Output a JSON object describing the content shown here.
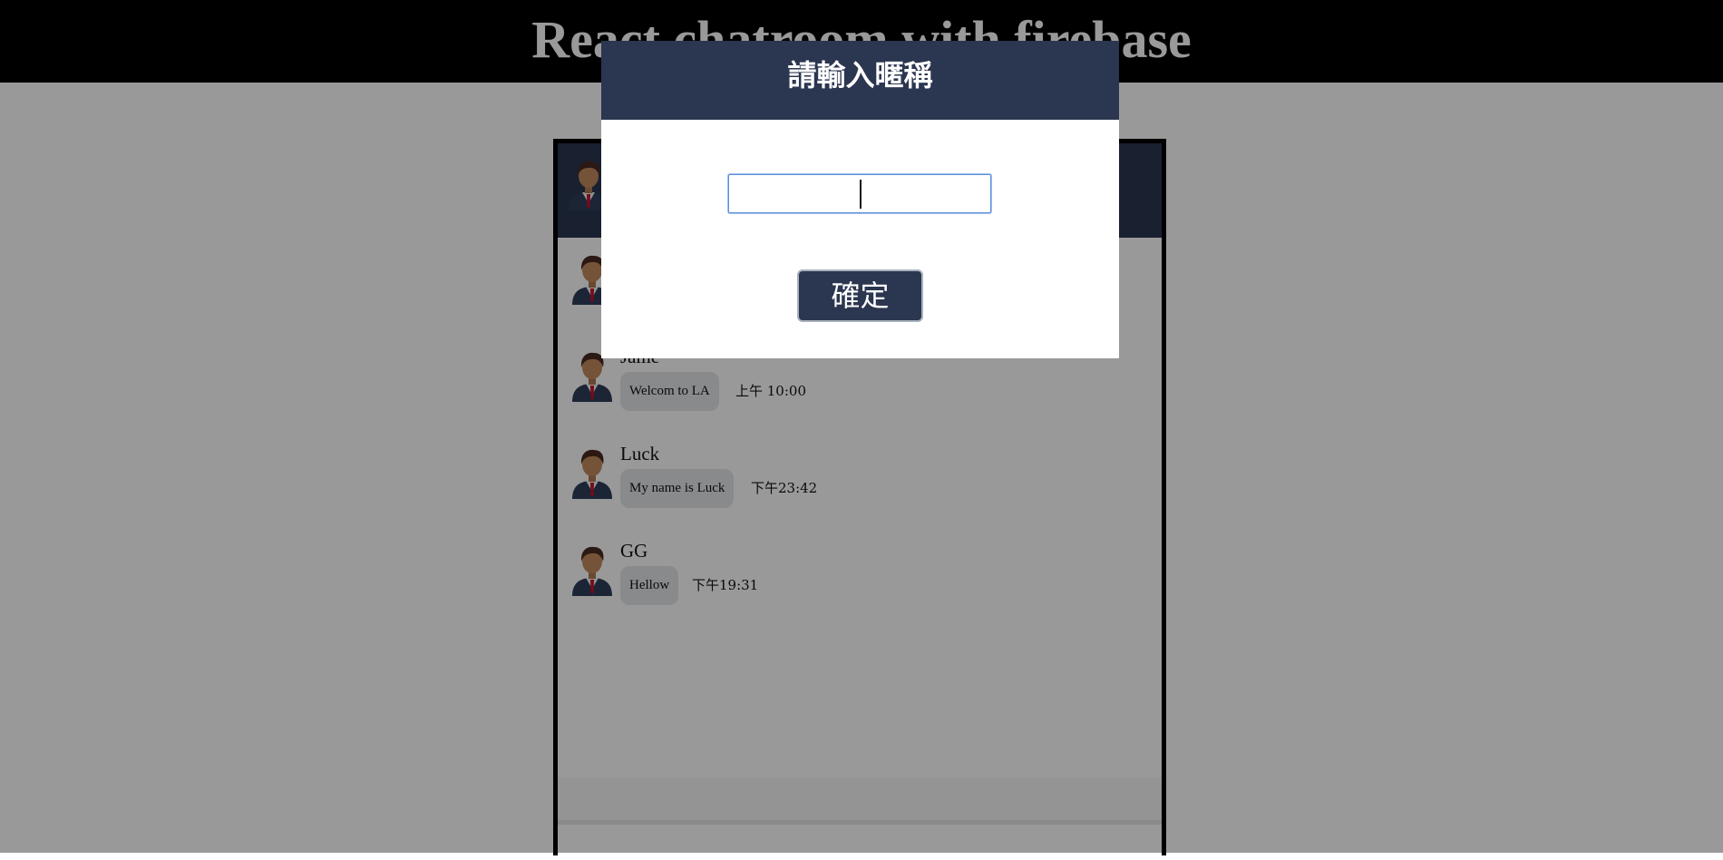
{
  "header": {
    "title": "React chatroom with firebase"
  },
  "chat": {
    "messages": [
      {
        "name": "",
        "text": "",
        "time": ""
      },
      {
        "name": "Jame",
        "text": "Welcom to LA",
        "time": "上午 10:00"
      },
      {
        "name": "Luck",
        "text": "My name is Luck",
        "time": "下午23:42"
      },
      {
        "name": "GG",
        "text": "Hellow",
        "time": "下午19:31"
      }
    ]
  },
  "modal": {
    "title": "請輸入暱稱",
    "input_value": "",
    "confirm_label": "確定"
  },
  "colors": {
    "navy": "#2b3650",
    "bubble": "#e3e6ea",
    "header_bg": "#000000"
  }
}
